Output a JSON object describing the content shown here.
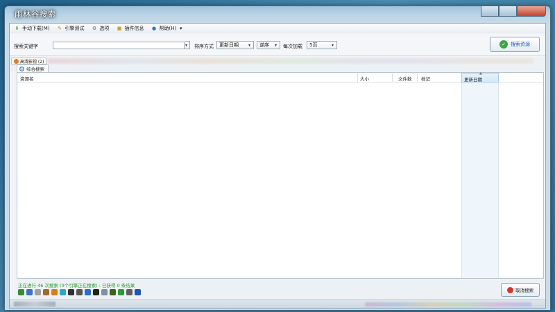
{
  "window": {
    "title": "雨林谷搜索"
  },
  "menu": {
    "items": [
      {
        "label": "手动下载(M)",
        "icon": "download-arrow-icon",
        "color": "#2e9b3a"
      },
      {
        "label": "引擎测试",
        "icon": "pencil-icon",
        "color": "#c77a1c"
      },
      {
        "label": "选项",
        "icon": "gear-icon",
        "color": "#607080"
      },
      {
        "label": "插件信息",
        "icon": "plugin-icon",
        "color": "#d0a030"
      },
      {
        "label": "帮助(H)",
        "icon": "help-icon",
        "color": "#3a6fc0"
      }
    ]
  },
  "toolbar": {
    "keyword_label": "搜索关键字",
    "keyword_value": "",
    "sort_label": "排序方式",
    "sort_value": "更新日期",
    "order_value": "逆序",
    "per_engine_label": "每次加载",
    "per_engine_value": "5页",
    "search_button": "搜索资源"
  },
  "tabs": {
    "site_tab": "高清影视 (2)",
    "active_tab": "综合搜索"
  },
  "table": {
    "columns": [
      {
        "label": "资源名"
      },
      {
        "label": "大小"
      },
      {
        "label": "文件数"
      },
      {
        "label": "标记"
      },
      {
        "label": "更新日期"
      }
    ]
  },
  "status": {
    "text": "正在进行 46 次搜索 (0个引擎正在搜索) : 已获得 0 条结果",
    "cancel_button": "取消搜索"
  },
  "engine_colors": [
    "#3a8a3a",
    "#3d6fc2",
    "#a0a0a0",
    "#a06a2a",
    "#d08020",
    "#2aa8c8",
    "#303030",
    "#555555",
    "#2a6fd0",
    "#202020",
    "#8090a0",
    "#406020",
    "#2e9b3a",
    "#606060",
    "#1f55b4"
  ],
  "colors": {
    "accent": "#1f55b4",
    "status_green": "#229922",
    "cancel_red": "#d8342a"
  }
}
